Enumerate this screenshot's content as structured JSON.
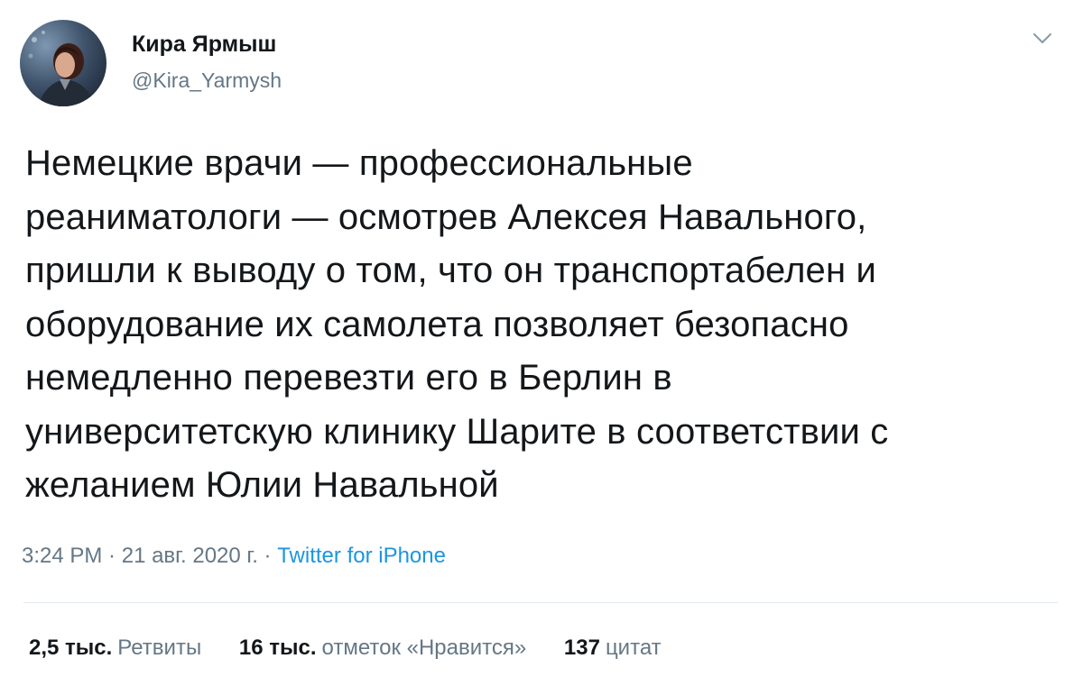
{
  "author": {
    "name": "Кира Ярмыш",
    "handle": "@Kira_Yarmysh",
    "avatar_icon": "profile-photo"
  },
  "menu_icon": "chevron-down-icon",
  "tweet": {
    "lines": [
      "Немецкие врачи — профессиональные",
      "реаниматологи — осмотрев Алексея Навального,",
      "пришли к выводу о том, что он транспортабелен и",
      "оборудование их самолета позволяет безопасно",
      "немедленно перевезти его в Берлин в",
      "университетскую клинику Шарите в соответствии с",
      "желанием Юлии Навальной"
    ]
  },
  "meta": {
    "time": "3:24 PM",
    "separator": " · ",
    "date": "21 авг. 2020 г.",
    "source": "Twitter for iPhone"
  },
  "stats": {
    "retweets_count": "2,5 тыс.",
    "retweets_label": "Ретвиты",
    "likes_count": "16 тыс.",
    "likes_label": "отметок «Нравится»",
    "quotes_count": "137",
    "quotes_label": "цитат"
  },
  "colors": {
    "text": "#14171a",
    "secondary": "#657786",
    "link": "#1b95e0",
    "divider": "#e1e8ed"
  }
}
